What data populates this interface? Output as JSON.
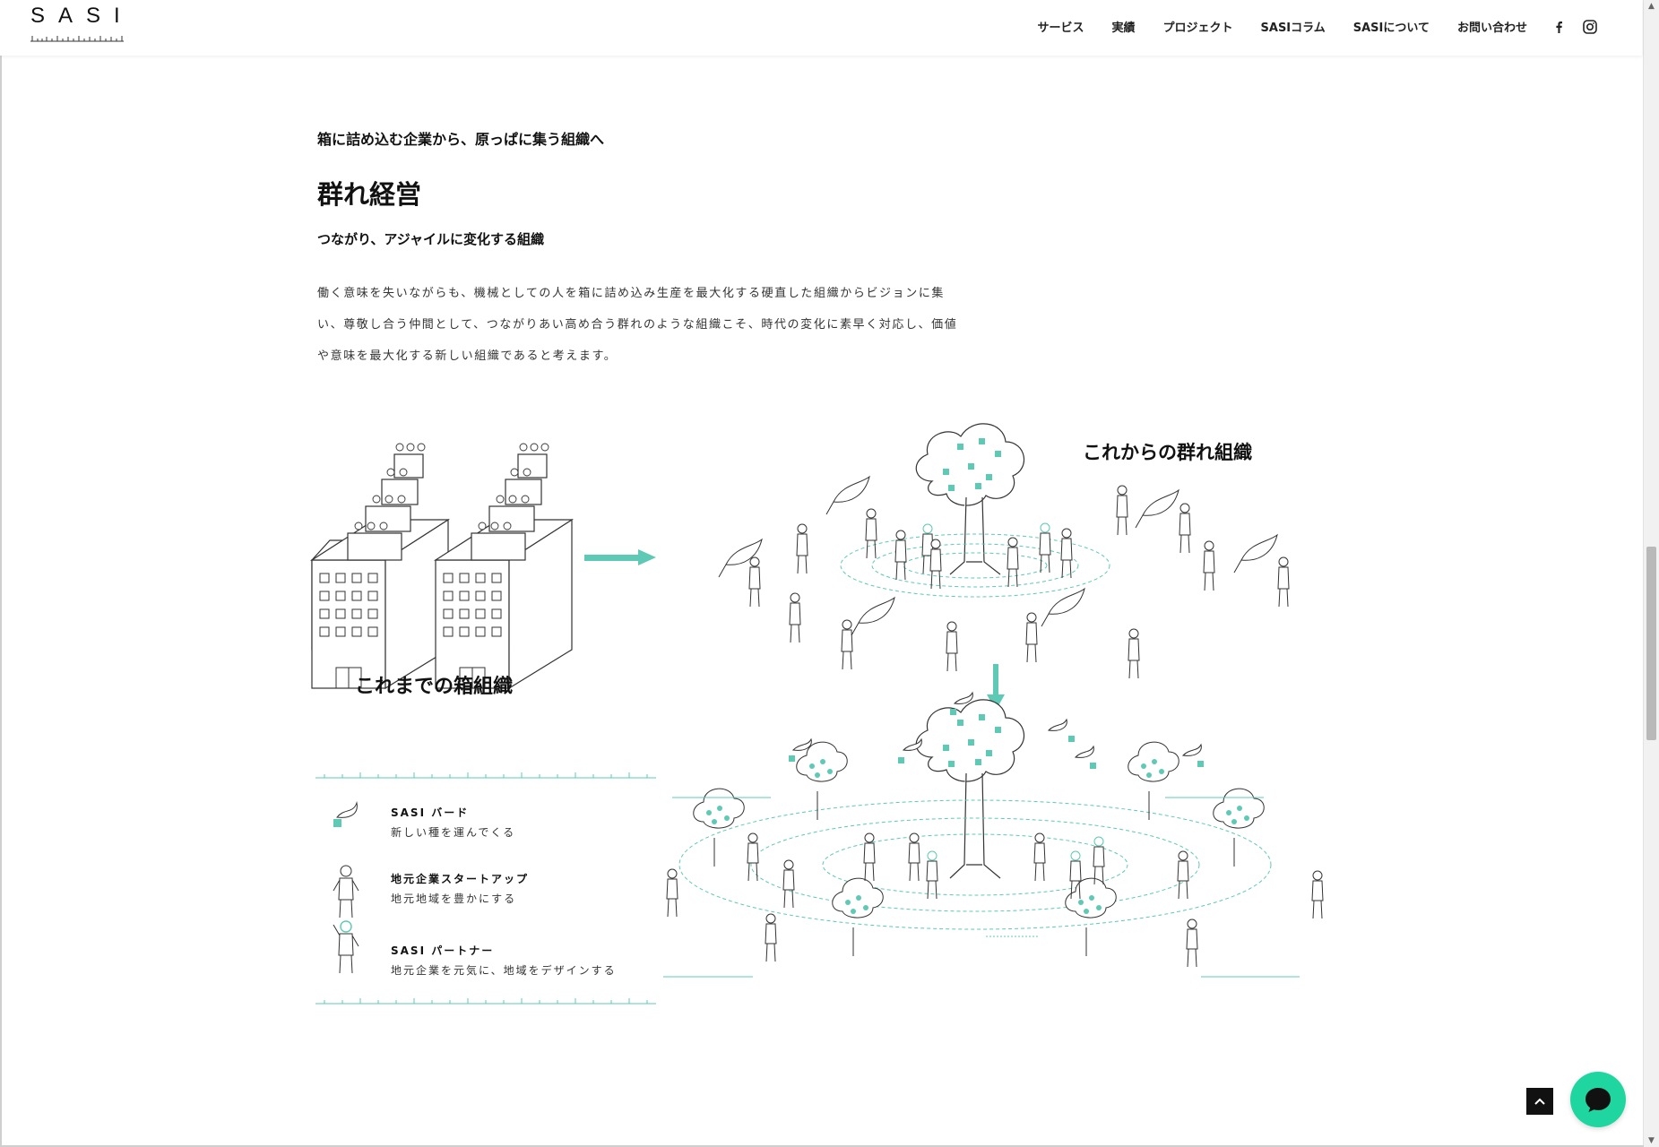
{
  "header": {
    "logo": "SASI",
    "nav": [
      "サービス",
      "実績",
      "プロジェクト",
      "SASIコラム",
      "SASIについて",
      "お問い合わせ"
    ],
    "icons": [
      "facebook-icon",
      "instagram-icon"
    ]
  },
  "section": {
    "eyebrow": "箱に詰め込む企業から、原っぱに集う組織へ",
    "title": "群れ経営",
    "subtitle": "つながり、アジャイルに変化する組織",
    "body_lines": [
      "働く意味を失いながらも、機械としての人を箱に詰め込み生産を最大化する硬直した組織からビジョンに集",
      "い、尊敬し合う仲間として、つながりあい高め合う群れのような組織こそ、時代の変化に素早く対応し、価値",
      "や意味を最大化する新しい組織であると考えます。"
    ]
  },
  "illustration": {
    "old_label": "これまでの箱組織",
    "new_label": "これからの群れ組織",
    "accent": "#5ec9b4"
  },
  "legend": [
    {
      "title": "SASI バード",
      "desc": "新しい種を運んでくる",
      "icon": "bird-icon"
    },
    {
      "title": "地元企業スタートアップ",
      "desc": "地元地域を豊かにする",
      "icon": "startup-person-icon"
    },
    {
      "title": "SASI パートナー",
      "desc": "地元企業を元気に、地域をデザインする",
      "icon": "partner-person-icon"
    }
  ],
  "widgets": {
    "to_top": "^",
    "chat_color": "#1fd6a0"
  }
}
